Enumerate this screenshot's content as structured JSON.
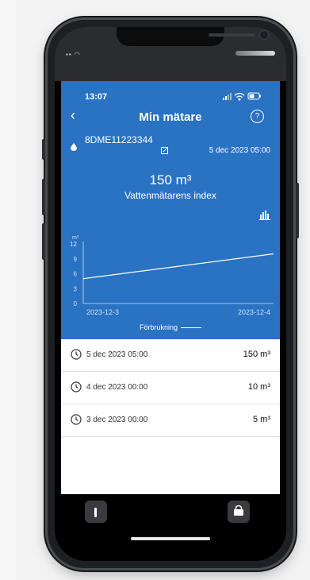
{
  "status": {
    "time": "13:07"
  },
  "nav": {
    "back": "‹",
    "title": "Min mätare",
    "help": "?"
  },
  "meter": {
    "id": "8DME11223344",
    "date": "5 dec 2023 05:00"
  },
  "index": {
    "value": "150 m³",
    "label": "Vattenmätarens index"
  },
  "chart_data": {
    "type": "line",
    "yunit": "m³",
    "yticks": [
      0,
      3,
      6,
      9,
      12
    ],
    "ylim": [
      0,
      12
    ],
    "xticks": [
      "2023-12-3",
      "2023-12-4"
    ],
    "series": [
      {
        "name": "Förbrukning",
        "values": [
          5,
          10
        ]
      }
    ],
    "legend": "bottom"
  },
  "readings": [
    {
      "datetime": "5 dec 2023 05:00",
      "value": "150 m³"
    },
    {
      "datetime": "4 dec 2023 00:00",
      "value": "10 m³"
    },
    {
      "datetime": "3 dec 2023 00:00",
      "value": "5 m³"
    }
  ],
  "colors": {
    "primary": "#2a72c2",
    "text_on_primary": "#ffffff"
  },
  "icons": [
    "back-icon",
    "help-icon",
    "water-drop-icon",
    "edit-icon",
    "bar-chart-icon",
    "clock-icon"
  ]
}
